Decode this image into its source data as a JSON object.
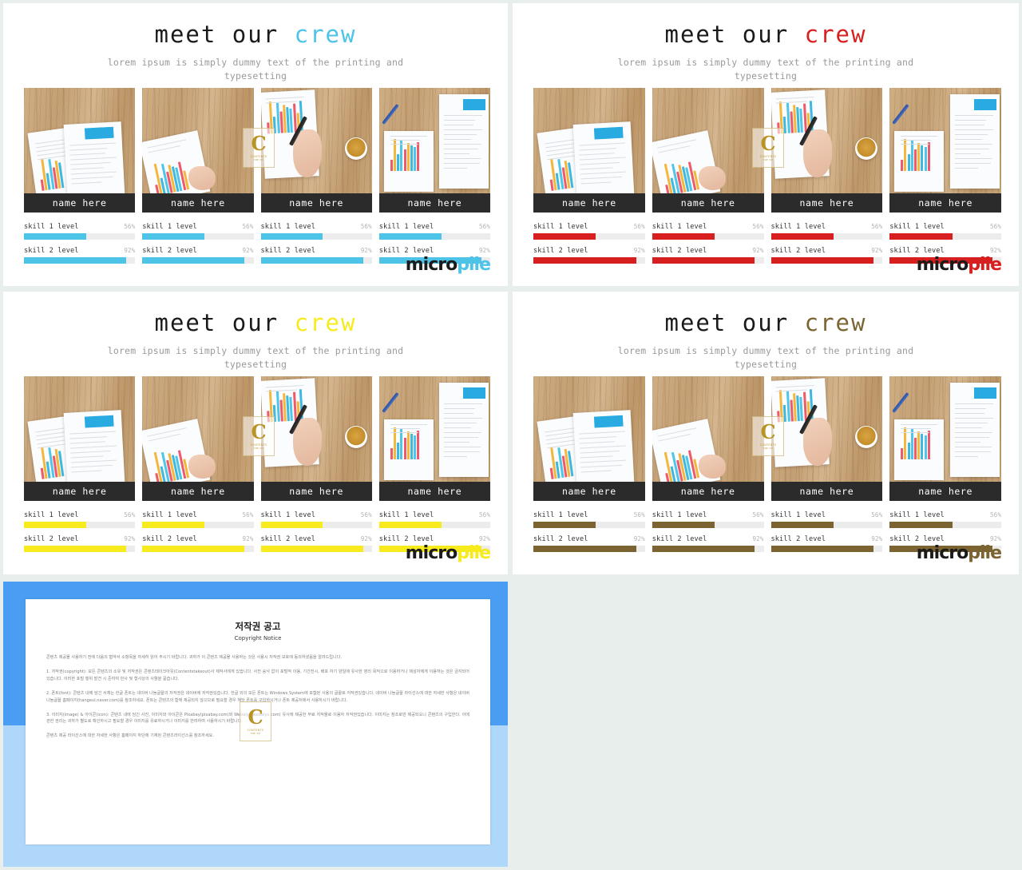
{
  "page": {
    "background": "#e8eeeb"
  },
  "slides": [
    {
      "id": "slide-cyan",
      "title_plain": "meet our ",
      "title_accent": "crew",
      "subtitle": "lorem ipsum is simply dummy text of the printing and typesetting",
      "accent_color": "#4ec3e8",
      "logo_micro": "micro",
      "logo_pile": "pile",
      "members": [
        {
          "name": "name here",
          "skills": [
            {
              "label": "skill 1 level",
              "pct": "56%",
              "value": 56
            },
            {
              "label": "skill 2 level",
              "pct": "92%",
              "value": 92
            }
          ]
        },
        {
          "name": "name here",
          "skills": [
            {
              "label": "skill 1 level",
              "pct": "56%",
              "value": 56
            },
            {
              "label": "skill 2 level",
              "pct": "92%",
              "value": 92
            }
          ]
        },
        {
          "name": "name here",
          "skills": [
            {
              "label": "skill 1 level",
              "pct": "56%",
              "value": 56
            },
            {
              "label": "skill 2 level",
              "pct": "92%",
              "value": 92
            }
          ]
        },
        {
          "name": "name here",
          "skills": [
            {
              "label": "skill 1 level",
              "pct": "56%",
              "value": 56
            },
            {
              "label": "skill 2 level",
              "pct": "92%",
              "value": 92
            }
          ]
        }
      ]
    },
    {
      "id": "slide-red",
      "title_plain": "meet our ",
      "title_accent": "crew",
      "subtitle": "lorem ipsum is simply dummy text of the printing and typesetting",
      "accent_color": "#d81f1f",
      "logo_micro": "micro",
      "logo_pile": "pile",
      "members": [
        {
          "name": "name here",
          "skills": [
            {
              "label": "skill 1 level",
              "pct": "56%",
              "value": 56
            },
            {
              "label": "skill 2 level",
              "pct": "92%",
              "value": 92
            }
          ]
        },
        {
          "name": "name here",
          "skills": [
            {
              "label": "skill 1 level",
              "pct": "56%",
              "value": 56
            },
            {
              "label": "skill 2 level",
              "pct": "92%",
              "value": 92
            }
          ]
        },
        {
          "name": "name here",
          "skills": [
            {
              "label": "skill 1 level",
              "pct": "56%",
              "value": 56
            },
            {
              "label": "skill 2 level",
              "pct": "92%",
              "value": 92
            }
          ]
        },
        {
          "name": "name here",
          "skills": [
            {
              "label": "skill 1 level",
              "pct": "56%",
              "value": 56
            },
            {
              "label": "skill 2 level",
              "pct": "92%",
              "value": 92
            }
          ]
        }
      ]
    },
    {
      "id": "slide-yellow",
      "title_plain": "meet our ",
      "title_accent": "crew",
      "subtitle": "lorem ipsum is simply dummy text of the printing and typesetting",
      "accent_color": "#f7eb1e",
      "logo_micro": "micro",
      "logo_pile": "pile",
      "members": [
        {
          "name": "name here",
          "skills": [
            {
              "label": "skill 1 level",
              "pct": "56%",
              "value": 56
            },
            {
              "label": "skill 2 level",
              "pct": "92%",
              "value": 92
            }
          ]
        },
        {
          "name": "name here",
          "skills": [
            {
              "label": "skill 1 level",
              "pct": "56%",
              "value": 56
            },
            {
              "label": "skill 2 level",
              "pct": "92%",
              "value": 92
            }
          ]
        },
        {
          "name": "name here",
          "skills": [
            {
              "label": "skill 1 level",
              "pct": "56%",
              "value": 56
            },
            {
              "label": "skill 2 level",
              "pct": "92%",
              "value": 92
            }
          ]
        },
        {
          "name": "name here",
          "skills": [
            {
              "label": "skill 1 level",
              "pct": "56%",
              "value": 56
            },
            {
              "label": "skill 2 level",
              "pct": "92%",
              "value": 92
            }
          ]
        }
      ]
    },
    {
      "id": "slide-brown",
      "title_plain": "meet our ",
      "title_accent": "crew",
      "subtitle": "lorem ipsum is simply dummy text of the printing and typesetting",
      "accent_color": "#7b6432",
      "logo_micro": "micro",
      "logo_pile": "pile",
      "members": [
        {
          "name": "name here",
          "skills": [
            {
              "label": "skill 1 level",
              "pct": "56%",
              "value": 56
            },
            {
              "label": "skill 2 level",
              "pct": "92%",
              "value": 92
            }
          ]
        },
        {
          "name": "name here",
          "skills": [
            {
              "label": "skill 1 level",
              "pct": "56%",
              "value": 56
            },
            {
              "label": "skill 2 level",
              "pct": "92%",
              "value": 92
            }
          ]
        },
        {
          "name": "name here",
          "skills": [
            {
              "label": "skill 1 level",
              "pct": "56%",
              "value": 56
            },
            {
              "label": "skill 2 level",
              "pct": "92%",
              "value": 92
            }
          ]
        },
        {
          "name": "name here",
          "skills": [
            {
              "label": "skill 1 level",
              "pct": "56%",
              "value": 56
            },
            {
              "label": "skill 2 level",
              "pct": "92%",
              "value": 92
            }
          ]
        }
      ]
    }
  ],
  "copyright_slide": {
    "frame_color_top": "#4a9df2",
    "frame_color_bottom": "#aed7f9",
    "title": "저작권 공고",
    "subtitle": "Copyright Notice",
    "paragraphs": [
      "콘텐츠 제공물 사용하기 전에 다음의 협약서 소항목을 자세히 읽어 주시기 바랍니다. 귀하가 이 콘텐츠 제공물 사용하는 것은 사용시 저작권 보호에 동의하셨음을 알려드립니다.",
      "1. 저작권(copyright): 모든 콘텐츠의 소유 및 저작권은 콘텐츠테이크아웃(Contentstakeout)사 제작사에게 있습니다. 사전 승낙 없이 포털적 이용, 기간전시, 배포 자기 양일에 유사한 영리 목적으로 이용하거나 제삼자에게 이용하는 것은 금지되어 있습니다. 이러한 포털 행위 발견 시 준하여 민사 및 형사상의 사항을 묻습니다.",
      "2. 폰트(font): 콘텐츠 내에 담긴 서체는 한글 폰트는 네이버 나눔글꼴의 저작권은 네이버에 저작권있습니다. 한글 외의 모든 폰트는 Windows System에 포함된 사용의 글꼴로 저작권있습니다. 네이버 나눔글꼴 라이선스에 대한 자세한 사항은 네이버 나눔글꼴 홈페이지(hangeul.naver.com)를 참조하세요. 폰트는 콘텐츠의 함께 제공되지 않으므로 필요할 경우 해당 폰트를 구입하시거나 폰트 제공처에서 사용하시기 바랍니다.",
      "3. 이미지(image) & 아이콘(icon): 콘텐츠 내에 담긴 사진, 이미지와 아이콘은 Pixabay(pixabay.com)와 Webalys(webalys.com) 유사에 제공한 무료 저작물로 이용자 저작권있습니다. 이미지는 참조로만 제공되오니 콘텐츠의 구입한다. 이에 관한 권리는 귀하가 별도로 확인하시고 필요할 경우 이미지를 유료하시거나 이미지를 반려하여 사용하시기 바랍니다.",
      "콘텐츠 제공 라이선스에 대한 자세한 사항은 홈페이지 하단에 기재된 콘텐츠라이선스를 참조하세요."
    ]
  }
}
